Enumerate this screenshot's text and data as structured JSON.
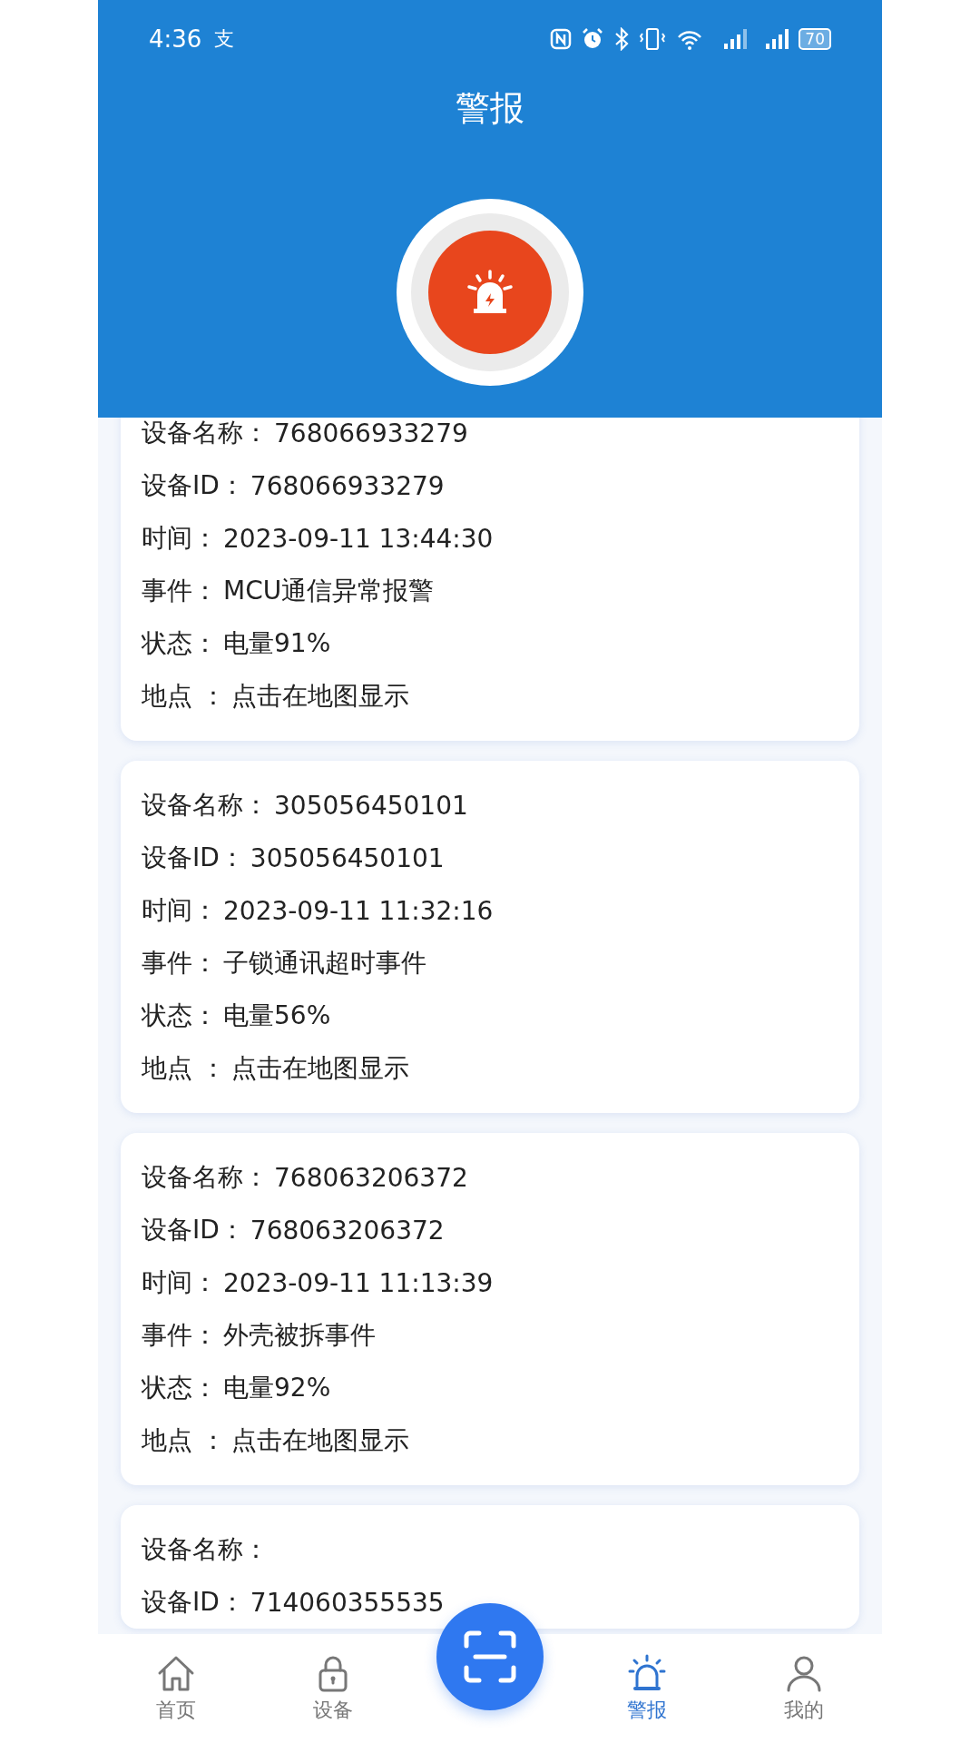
{
  "status_bar": {
    "time": "4:36",
    "app_icon": "支",
    "battery": "70"
  },
  "header": {
    "title": "警报"
  },
  "alarms": [
    {
      "fields": [
        {
          "label": "设备名称：",
          "value": "768066933279"
        },
        {
          "label": "设备ID：",
          "value": "768066933279"
        },
        {
          "label": "时间：",
          "value": "2023-09-11 13:44:30"
        },
        {
          "label": "事件：",
          "value": "MCU通信异常报警"
        },
        {
          "label": "状态：",
          "value": "电量91%"
        },
        {
          "label": "地点 ：",
          "value": "点击在地图显示"
        }
      ]
    },
    {
      "fields": [
        {
          "label": "设备名称：",
          "value": "305056450101"
        },
        {
          "label": "设备ID：",
          "value": "305056450101"
        },
        {
          "label": "时间：",
          "value": "2023-09-11 11:32:16"
        },
        {
          "label": "事件：",
          "value": "子锁通讯超时事件"
        },
        {
          "label": "状态：",
          "value": "电量56%"
        },
        {
          "label": "地点 ：",
          "value": "点击在地图显示"
        }
      ]
    },
    {
      "fields": [
        {
          "label": "设备名称：",
          "value": "768063206372"
        },
        {
          "label": "设备ID：",
          "value": "768063206372"
        },
        {
          "label": "时间：",
          "value": "2023-09-11 11:13:39"
        },
        {
          "label": "事件：",
          "value": "外壳被拆事件"
        },
        {
          "label": "状态：",
          "value": "电量92%"
        },
        {
          "label": "地点 ：",
          "value": "点击在地图显示"
        }
      ]
    },
    {
      "fields": [
        {
          "label": "设备名称："
        },
        {
          "label": "设备ID：",
          "value": "714060355535"
        }
      ]
    }
  ],
  "nav": [
    {
      "kind": "home",
      "label": "首页",
      "selected": false
    },
    {
      "kind": "lock",
      "label": "设备",
      "selected": false
    },
    {
      "kind": "scan"
    },
    {
      "kind": "alarm",
      "label": "警报",
      "selected": true
    },
    {
      "kind": "user",
      "label": "我的",
      "selected": false
    }
  ]
}
